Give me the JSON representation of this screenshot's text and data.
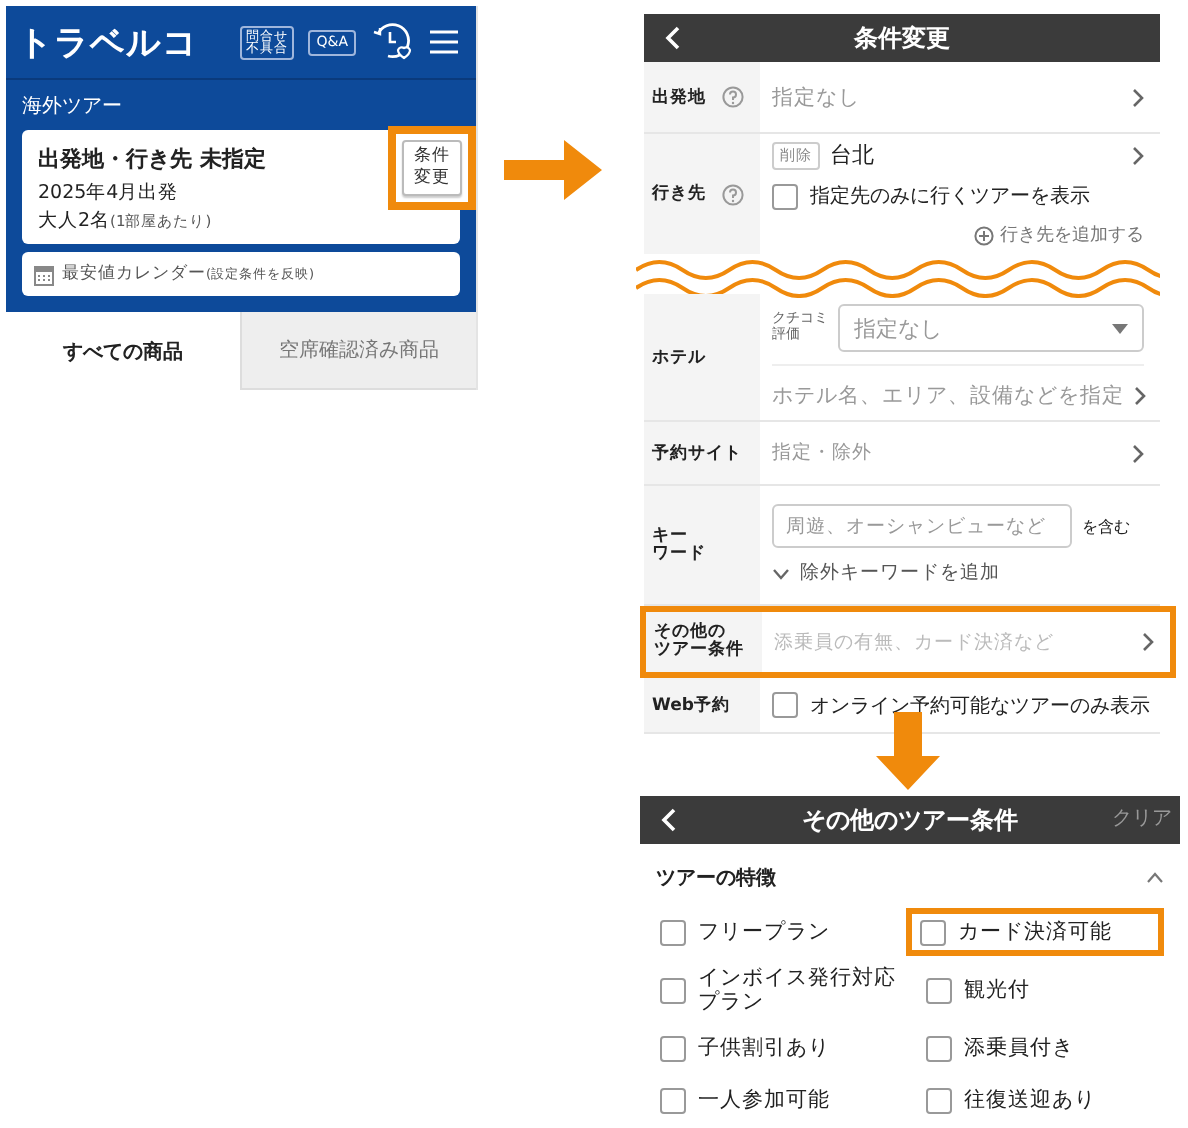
{
  "search_screen": {
    "logo": "トラベルコ",
    "inquiry_badge": [
      "問合せ",
      "不具合"
    ],
    "qa_badge": "Q&A",
    "category": "海外ツアー",
    "summary": {
      "title": "出発地・行き先 未指定",
      "date": "2025年4月出発",
      "guests": "大人2名",
      "guests_note": "(1部屋あたり)",
      "button_lines": [
        "条件",
        "変更"
      ],
      "highlighted": true
    },
    "calendar_link": {
      "label": "最安値カレンダー",
      "note": "(設定条件を反映)"
    },
    "tabs": [
      {
        "label": "すべての商品",
        "selected": true
      },
      {
        "label": "空席確認済み商品",
        "selected": false
      }
    ]
  },
  "conditions_screen": {
    "title": "条件変更",
    "departure": {
      "label": "出発地",
      "value": "指定なし"
    },
    "destination": {
      "label": "行き先",
      "tag": "削除",
      "value": "台北",
      "checkbox": {
        "label": "指定先のみに行くツアーを表示",
        "checked": false
      },
      "add_link": "行き先を追加する"
    },
    "hotel": {
      "label": "ホテル",
      "rating_label": [
        "クチコミ",
        "評価"
      ],
      "rating_value": "指定なし",
      "detail": "ホテル名、エリア、設備などを指定"
    },
    "booking_site": {
      "label": "予約サイト",
      "value": "指定・除外"
    },
    "keyword": {
      "label_lines": [
        "キー",
        "ワード"
      ],
      "placeholder": "周遊、オーシャンビューなど",
      "suffix": "を含む",
      "exclude_link": "除外キーワードを追加"
    },
    "other": {
      "label_lines": [
        "その他の",
        "ツアー条件"
      ],
      "value": "添乗員の有無、カード決済など",
      "highlighted": true
    },
    "web": {
      "label": "Web予約",
      "checkbox": {
        "label": "オンライン予約可能なツアーのみ表示",
        "checked": false
      }
    }
  },
  "other_screen": {
    "title": "その他のツアー条件",
    "clear": "クリア",
    "section": {
      "title": "ツアーの特徴",
      "expanded": true
    },
    "options": [
      {
        "label": "フリープラン",
        "checked": false,
        "highlighted": false
      },
      {
        "label": "カード決済可能",
        "checked": false,
        "highlighted": true
      },
      {
        "label": "インボイス発行対応プラン",
        "checked": false,
        "highlighted": false
      },
      {
        "label": "観光付",
        "checked": false,
        "highlighted": false
      },
      {
        "label": "子供割引あり",
        "checked": false,
        "highlighted": false
      },
      {
        "label": "添乗員付き",
        "checked": false,
        "highlighted": false
      },
      {
        "label": "一人参加可能",
        "checked": false,
        "highlighted": false
      },
      {
        "label": "往復送迎あり",
        "checked": false,
        "highlighted": false
      }
    ]
  }
}
